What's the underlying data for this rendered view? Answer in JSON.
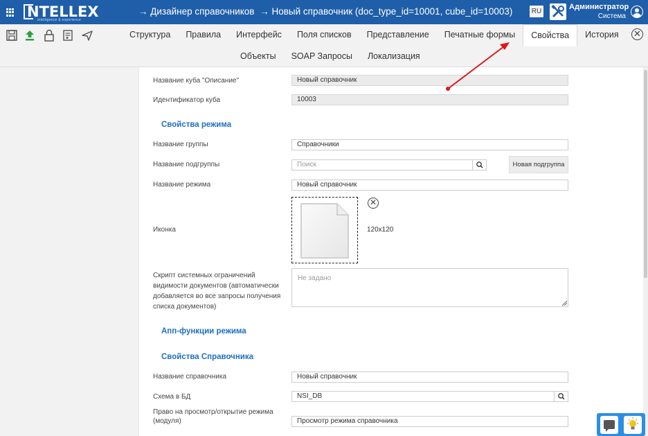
{
  "header": {
    "logo_text": "NTELLEX",
    "logo_tagline": "intelligence & experience",
    "breadcrumb": [
      "→ Дизайнер справочников",
      "→ Новый справочник (doc_type_id=10001, cube_id=10003)"
    ],
    "lang": "RU",
    "user_name": "Администратор",
    "user_role": "Система"
  },
  "tabs_row1": [
    "Структура",
    "Правила",
    "Интерфейс",
    "Поля списков",
    "Представление",
    "Печатные формы",
    "Свойства",
    "История"
  ],
  "tabs_row2": [
    "Объекты",
    "SOAP Запросы",
    "Локализация"
  ],
  "active_tab": "Свойства",
  "form": {
    "cube_desc_label": "Название куба \"Описание\"",
    "cube_desc_value": "Новый справочник",
    "cube_id_label": "Идентификатор куба",
    "cube_id_value": "10003",
    "mode_section": "Свойства режима",
    "group_label": "Название группы",
    "group_value": "Справочники",
    "subgroup_label": "Название подгруппы",
    "subgroup_placeholder": "Поиск",
    "new_subgroup_button": "Новая подгруппа",
    "mode_name_label": "Название режима",
    "mode_name_value": "Новый справочник",
    "icon_label": "Иконка",
    "icon_size": "120x120",
    "script_label": "Скрипт системных ограничений видимости документов (автоматически добавляется во все запросы получения списка документов)",
    "script_placeholder": "Не задано",
    "app_section": "Апп-функции режима",
    "ref_section": "Свойства Справочника",
    "ref_name_label": "Название справочника",
    "ref_name_value": "Новый справочник",
    "schema_label": "Схема в БД",
    "schema_value": "NSI_DB",
    "right_label": "Право на просмотр/открытие режима (модуля)",
    "right_value": "Просмотр режима справочника"
  },
  "colors": {
    "topbar": "#1f5ea8",
    "section": "#1f6fbf",
    "annotation": "#e0161c"
  }
}
